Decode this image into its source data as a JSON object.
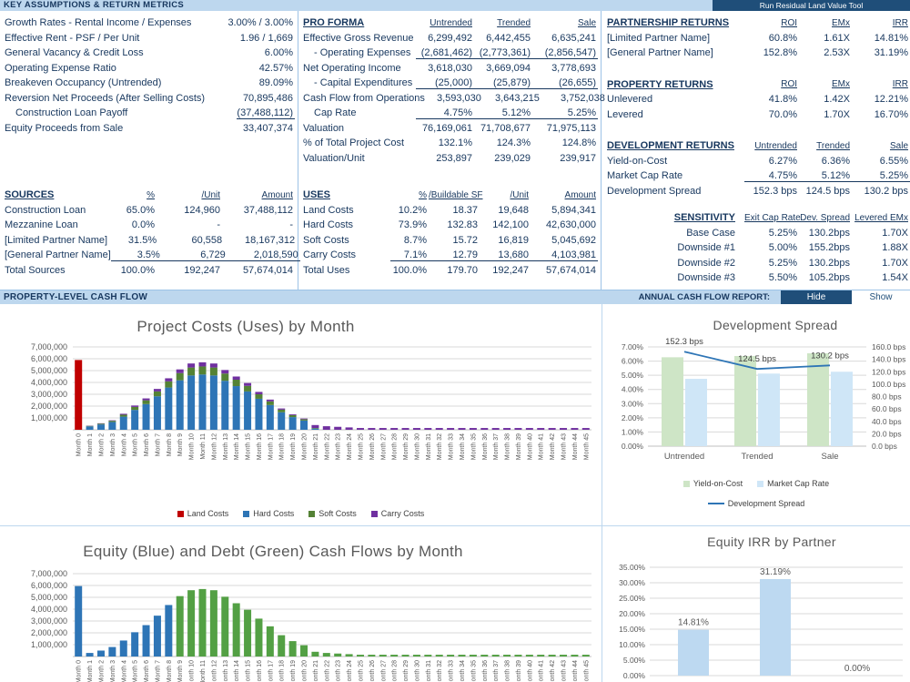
{
  "header": {
    "title": "KEY ASSUMPTIONS & RETURN METRICS",
    "run_tool_button": "Run Residual Land Value Tool"
  },
  "assumptions": {
    "rows": [
      {
        "label": "Growth Rates - Rental Income / Expenses",
        "value": "3.00% / 3.00%"
      },
      {
        "label": "Effective Rent - PSF / Per Unit",
        "value": "1.96 / 1,669"
      },
      {
        "label": "General Vacancy & Credit Loss",
        "value": "6.00%"
      },
      {
        "label": "Operating Expense Ratio",
        "value": "42.57%"
      },
      {
        "label": "Breakeven Occupancy (Untrended)",
        "value": "89.09%"
      },
      {
        "label": "Reversion Net Proceeds (After Selling Costs)",
        "value": "70,895,486"
      },
      {
        "label": "Construction Loan Payoff",
        "value": "(37,488,112)",
        "indent": true,
        "underline": true
      },
      {
        "label": "Equity Proceeds from Sale",
        "value": "33,407,374"
      }
    ]
  },
  "pro_forma": {
    "title": "PRO FORMA",
    "headers": [
      "Untrended",
      "Trended",
      "Sale"
    ],
    "rows": [
      {
        "label": "Effective Gross Revenue",
        "values": [
          "6,299,492",
          "6,442,455",
          "6,635,241"
        ]
      },
      {
        "label": "- Operating Expenses",
        "values": [
          "(2,681,462)",
          "(2,773,361)",
          "(2,856,547)"
        ],
        "indent": true,
        "underline": true
      },
      {
        "label": "Net Operating Income",
        "values": [
          "3,618,030",
          "3,669,094",
          "3,778,693"
        ]
      },
      {
        "label": "- Capital Expenditures",
        "values": [
          "(25,000)",
          "(25,879)",
          "(26,655)"
        ],
        "indent": true,
        "underline": true
      },
      {
        "label": "Cash Flow from Operations",
        "values": [
          "3,593,030",
          "3,643,215",
          "3,752,038"
        ]
      },
      {
        "label": "Cap Rate",
        "values": [
          "4.75%",
          "5.12%",
          "5.25%"
        ],
        "indent": true,
        "underline": true
      },
      {
        "label": "Valuation",
        "values": [
          "76,169,061",
          "71,708,677",
          "71,975,113"
        ]
      },
      {
        "label": "% of Total Project Cost",
        "values": [
          "132.1%",
          "124.3%",
          "124.8%"
        ]
      },
      {
        "label": "Valuation/Unit",
        "values": [
          "253,897",
          "239,029",
          "239,917"
        ]
      }
    ]
  },
  "sources": {
    "title": "SOURCES",
    "headers": [
      "%",
      "/Unit",
      "Amount"
    ],
    "rows": [
      {
        "label": "Construction Loan",
        "values": [
          "65.0%",
          "124,960",
          "37,488,112"
        ]
      },
      {
        "label": "Mezzanine Loan",
        "values": [
          "0.0%",
          "-",
          "-"
        ]
      },
      {
        "label": "[Limited Partner Name]",
        "values": [
          "31.5%",
          "60,558",
          "18,167,312"
        ]
      },
      {
        "label": "[General Partner Name]",
        "values": [
          "3.5%",
          "6,729",
          "2,018,590"
        ],
        "underline": true
      },
      {
        "label": "Total Sources",
        "values": [
          "100.0%",
          "192,247",
          "57,674,014"
        ]
      }
    ]
  },
  "uses": {
    "title": "USES",
    "headers": [
      "%",
      "/Buildable SF",
      "/Unit",
      "Amount"
    ],
    "rows": [
      {
        "label": "Land Costs",
        "values": [
          "10.2%",
          "18.37",
          "19,648",
          "5,894,341"
        ]
      },
      {
        "label": "Hard Costs",
        "values": [
          "73.9%",
          "132.83",
          "142,100",
          "42,630,000"
        ]
      },
      {
        "label": "Soft Costs",
        "values": [
          "8.7%",
          "15.72",
          "16,819",
          "5,045,692"
        ]
      },
      {
        "label": "Carry Costs",
        "values": [
          "7.1%",
          "12.79",
          "13,680",
          "4,103,981"
        ],
        "underline": true
      },
      {
        "label": "Total Uses",
        "values": [
          "100.0%",
          "179.70",
          "192,247",
          "57,674,014"
        ]
      }
    ]
  },
  "partnership_returns": {
    "title": "PARTNERSHIP RETURNS",
    "headers": [
      "ROI",
      "EMx",
      "IRR"
    ],
    "rows": [
      {
        "label": "[Limited Partner Name]",
        "values": [
          "60.8%",
          "1.61X",
          "14.81%"
        ]
      },
      {
        "label": "[General Partner Name]",
        "values": [
          "152.8%",
          "2.53X",
          "31.19%"
        ]
      }
    ]
  },
  "property_returns": {
    "title": "PROPERTY RETURNS",
    "headers": [
      "ROI",
      "EMx",
      "IRR"
    ],
    "rows": [
      {
        "label": "Unlevered",
        "values": [
          "41.8%",
          "1.42X",
          "12.21%"
        ]
      },
      {
        "label": "Levered",
        "values": [
          "70.0%",
          "1.70X",
          "16.70%"
        ]
      }
    ]
  },
  "development_returns": {
    "title": "DEVELOPMENT RETURNS",
    "headers": [
      "Untrended",
      "Trended",
      "Sale"
    ],
    "rows": [
      {
        "label": "Yield-on-Cost",
        "values": [
          "6.27%",
          "6.36%",
          "6.55%"
        ]
      },
      {
        "label": "Market Cap Rate",
        "values": [
          "4.75%",
          "5.12%",
          "5.25%"
        ],
        "underline": true
      },
      {
        "label": "Development Spread",
        "values": [
          "152.3 bps",
          "124.5 bps",
          "130.2 bps"
        ]
      }
    ]
  },
  "sensitivity": {
    "title": "SENSITIVITY",
    "headers": [
      "Exit Cap Rate",
      "Dev. Spread",
      "Levered EMx"
    ],
    "rows": [
      {
        "label": "Base Case",
        "values": [
          "5.25%",
          "130.2bps",
          "1.70X"
        ]
      },
      {
        "label": "Downside #1",
        "values": [
          "5.00%",
          "155.2bps",
          "1.88X"
        ]
      },
      {
        "label": "Downside #2",
        "values": [
          "5.25%",
          "130.2bps",
          "1.70X"
        ]
      },
      {
        "label": "Downside #3",
        "values": [
          "5.50%",
          "105.2bps",
          "1.54X"
        ]
      }
    ]
  },
  "cashflow_bar": {
    "title": "PROPERTY-LEVEL CASH FLOW",
    "report_label": "ANNUAL CASH FLOW REPORT:",
    "hide_button": "Hide",
    "show_button": "Show"
  },
  "chart_data": [
    {
      "id": "project-costs",
      "type": "bar",
      "stacked": true,
      "title": "Project Costs (Uses) by Month",
      "x_labels": {
        "prefix": "Month ",
        "from": 0,
        "to": 45
      },
      "y_ticks": [
        "1,000,000",
        "2,000,000",
        "3,000,000",
        "4,000,000",
        "5,000,000",
        "6,000,000",
        "7,000,000"
      ],
      "ylim": [
        0,
        7000000
      ],
      "series": [
        {
          "name": "Land Costs",
          "color": "#C00000",
          "values": [
            5894341,
            0,
            0,
            0,
            0,
            0,
            0,
            0,
            0,
            0,
            0,
            0,
            0,
            0,
            0,
            0,
            0,
            0,
            0,
            0,
            0,
            0,
            0,
            0,
            0,
            0,
            0,
            0,
            0,
            0,
            0,
            0,
            0,
            0,
            0,
            0,
            0,
            0,
            0,
            0,
            0,
            0,
            0,
            0,
            0,
            0
          ]
        },
        {
          "name": "Hard Costs",
          "color": "#2E75B6",
          "values": [
            0,
            290000,
            450000,
            660000,
            1110000,
            1680000,
            2170000,
            2830000,
            3570000,
            4180000,
            4590000,
            4670000,
            4590000,
            4140000,
            3690000,
            3240000,
            2620000,
            2090000,
            1480000,
            1070000,
            780000,
            100000,
            0,
            0,
            0,
            0,
            0,
            0,
            0,
            0,
            0,
            0,
            0,
            0,
            0,
            0,
            0,
            0,
            0,
            0,
            0,
            0,
            0,
            0,
            0,
            0
          ]
        },
        {
          "name": "Soft Costs",
          "color": "#548235",
          "values": [
            0,
            40000,
            70000,
            100000,
            160000,
            250000,
            320000,
            410000,
            520000,
            610000,
            670000,
            680000,
            670000,
            610000,
            540000,
            470000,
            380000,
            310000,
            220000,
            160000,
            110000,
            50000,
            0,
            0,
            0,
            0,
            0,
            0,
            0,
            0,
            0,
            0,
            0,
            0,
            0,
            0,
            0,
            0,
            0,
            0,
            0,
            0,
            0,
            0,
            0,
            0
          ]
        },
        {
          "name": "Carry Costs",
          "color": "#7030A0",
          "values": [
            0,
            20000,
            30000,
            40000,
            80000,
            120000,
            160000,
            210000,
            260000,
            310000,
            340000,
            350000,
            340000,
            300000,
            270000,
            240000,
            200000,
            150000,
            100000,
            70000,
            60000,
            250000,
            300000,
            250000,
            200000,
            150000,
            150000,
            150000,
            150000,
            150000,
            150000,
            150000,
            150000,
            150000,
            150000,
            150000,
            150000,
            150000,
            150000,
            150000,
            150000,
            150000,
            150000,
            150000,
            150000,
            150000
          ]
        }
      ]
    },
    {
      "id": "development-spread",
      "type": "combo",
      "title": "Development Spread",
      "categories": [
        "Untrended",
        "Trended",
        "Sale"
      ],
      "bar_series": [
        {
          "name": "Yield-on-Cost",
          "color": "#CEE5C6",
          "values": [
            6.27,
            6.36,
            6.55
          ]
        },
        {
          "name": "Market Cap Rate",
          "color": "#CFE6F7",
          "values": [
            4.75,
            5.12,
            5.25
          ]
        }
      ],
      "line_series": {
        "name": "Development Spread",
        "color": "#2E75B6",
        "values": [
          152.3,
          124.5,
          130.2
        ],
        "labels": [
          "152.3 bps",
          "124.5 bps",
          "130.2 bps"
        ]
      },
      "left_axis": {
        "ticks": [
          "0.00%",
          "1.00%",
          "2.00%",
          "3.00%",
          "4.00%",
          "5.00%",
          "6.00%",
          "7.00%"
        ],
        "max": 7
      },
      "right_axis": {
        "ticks": [
          "0.0 bps",
          "20.0 bps",
          "40.0 bps",
          "60.0 bps",
          "80.0 bps",
          "100.0 bps",
          "120.0 bps",
          "140.0 bps",
          "160.0 bps"
        ],
        "max": 160
      }
    },
    {
      "id": "equity-debt-cashflows",
      "type": "bar",
      "stacked": true,
      "title": "Equity (Blue) and Debt (Green) Cash Flows by Month",
      "x_labels": {
        "prefix": "Month ",
        "from": 0,
        "to": 45
      },
      "y_ticks": [
        "1,000,000",
        "2,000,000",
        "3,000,000",
        "4,000,000",
        "5,000,000",
        "6,000,000",
        "7,000,000"
      ],
      "ylim": [
        0,
        7000000
      ],
      "series": [
        {
          "name": "Equity",
          "color": "#2E75B6",
          "values": [
            5950000,
            300000,
            500000,
            800000,
            1350000,
            2050000,
            2650000,
            3450000,
            4350000,
            0,
            0,
            0,
            0,
            0,
            0,
            0,
            0,
            0,
            0,
            0,
            0,
            0,
            0,
            0,
            0,
            0,
            0,
            0,
            0,
            0,
            0,
            0,
            0,
            0,
            0,
            0,
            0,
            0,
            0,
            0,
            0,
            0,
            0,
            0,
            0,
            0
          ]
        },
        {
          "name": "Debt",
          "color": "#53A044",
          "values": [
            0,
            0,
            0,
            0,
            0,
            0,
            0,
            0,
            0,
            5100000,
            5600000,
            5700000,
            5600000,
            5050000,
            4500000,
            3950000,
            3200000,
            2550000,
            1800000,
            1300000,
            950000,
            400000,
            300000,
            250000,
            200000,
            150000,
            150000,
            150000,
            150000,
            150000,
            150000,
            150000,
            150000,
            150000,
            150000,
            150000,
            150000,
            150000,
            150000,
            150000,
            150000,
            150000,
            150000,
            150000,
            150000,
            150000
          ]
        }
      ]
    },
    {
      "id": "equity-irr",
      "type": "bar",
      "title": "Equity IRR by Partner",
      "values": [
        14.81,
        31.19,
        0.0
      ],
      "labels": [
        "14.81%",
        "31.19%",
        "0.00%"
      ],
      "color": "#BDD9F1",
      "y_ticks": [
        "0.00%",
        "5.00%",
        "10.00%",
        "15.00%",
        "20.00%",
        "25.00%",
        "30.00%",
        "35.00%"
      ],
      "ylim": [
        0,
        35
      ]
    }
  ]
}
